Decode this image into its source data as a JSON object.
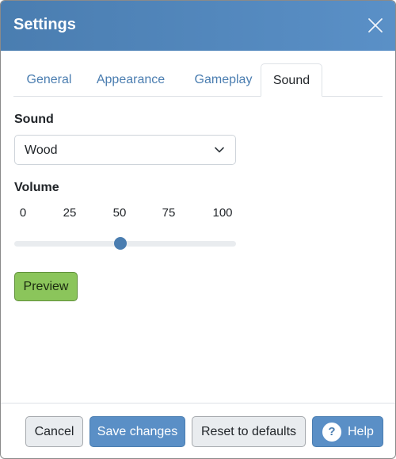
{
  "dialog": {
    "title": "Settings",
    "close_icon": "close-icon"
  },
  "tabs": [
    {
      "label": "General",
      "active": false
    },
    {
      "label": "Appearance",
      "active": false
    },
    {
      "label": "Gameplay",
      "active": false
    },
    {
      "label": "Sound",
      "active": true
    }
  ],
  "sound": {
    "label": "Sound",
    "selected": "Wood",
    "dropdown_icon": "chevron-down-icon"
  },
  "volume": {
    "label": "Volume",
    "ticks": [
      "0",
      "25",
      "50",
      "75",
      "100"
    ],
    "value": 50,
    "min": 0,
    "max": 100
  },
  "preview_label": "Preview",
  "footer": {
    "cancel": "Cancel",
    "save": "Save changes",
    "reset": "Reset to defaults",
    "help": "Help",
    "help_icon": "question-circle-icon",
    "help_glyph": "?"
  },
  "colors": {
    "header": "#4a7db0",
    "accent": "#5a8fc6",
    "preview_green": "#8bc55b"
  }
}
